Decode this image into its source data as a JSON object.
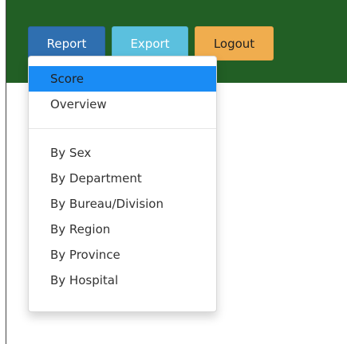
{
  "toolbar": {
    "report_label": "Report",
    "export_label": "Export",
    "logout_label": "Logout"
  },
  "colors": {
    "topbar_bg": "#225f25",
    "report_bg": "#2f6fb0",
    "export_bg": "#5bc0de",
    "logout_bg": "#f0ad4e",
    "active_item_bg": "#1a8cf5"
  },
  "report_menu": {
    "group1": [
      {
        "label": "Score",
        "active": true
      },
      {
        "label": "Overview",
        "active": false
      }
    ],
    "group2": [
      {
        "label": "By Sex",
        "active": false
      },
      {
        "label": "By Department",
        "active": false
      },
      {
        "label": "By Bureau/Division",
        "active": false
      },
      {
        "label": "By Region",
        "active": false
      },
      {
        "label": "By Province",
        "active": false
      },
      {
        "label": "By Hospital",
        "active": false
      }
    ]
  }
}
